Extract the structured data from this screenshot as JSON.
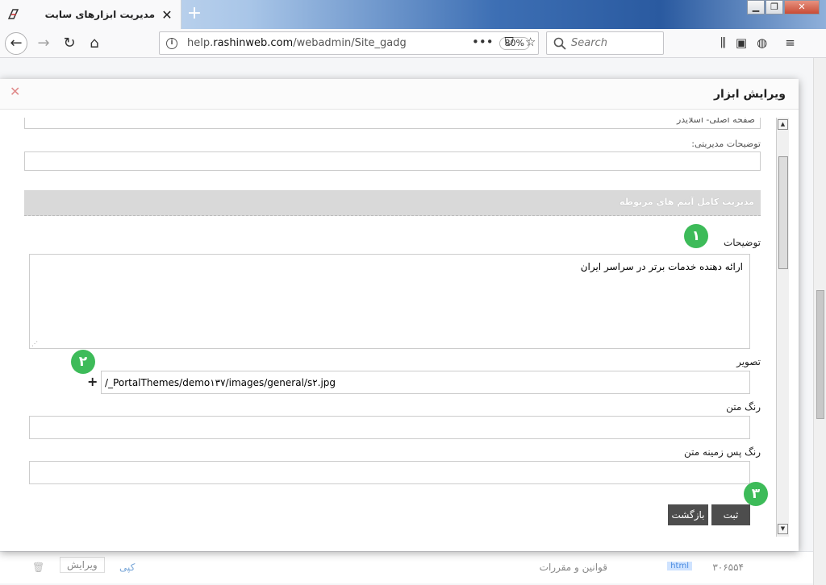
{
  "browser": {
    "tab_title": "مدیریت ابزارهای سایت",
    "tab_close": "✕",
    "new_tab": "+",
    "url_prefix": "help.",
    "url_domain": "rashinweb.com",
    "url_path": "/webadmin/Site_gadg",
    "zoom": "80%",
    "search_placeholder": "Search"
  },
  "background": {
    "row_title": "قوانین و مقررات",
    "row_id": "۳۰۶۵۵۴",
    "row_badge": "html",
    "row_copy": "کپی",
    "row_edit": "ویرایش"
  },
  "modal": {
    "title": "ویرایش ابزار",
    "close": "✕",
    "top_field_value": "صفحه اصلی- اسلایدر",
    "admin_notes_label": "توضیحات مدیریتی:",
    "section_title": "مدیریت کامل آیتم های مربوطه",
    "description_label": "توضیحات",
    "description_value": "ارائه دهنده خدمات برتر در سراسر ایران",
    "image_label": "تصویر",
    "image_value": "/_PortalThemes/demo۱۳۷/images/general/s۲.jpg",
    "image_add": "+",
    "text_color_label": "رنگ متن",
    "text_bg_color_label": "رنگ پس زمینه متن",
    "save_label": "ثبت",
    "back_label": "بازگشت"
  },
  "annotations": {
    "badge_1": "۱",
    "badge_2": "۲",
    "badge_3": "۳"
  },
  "colors": {
    "button_bg": "#4d4d4d",
    "badge_green": "#3dbb59",
    "section_bar": "#d9d9d9"
  }
}
